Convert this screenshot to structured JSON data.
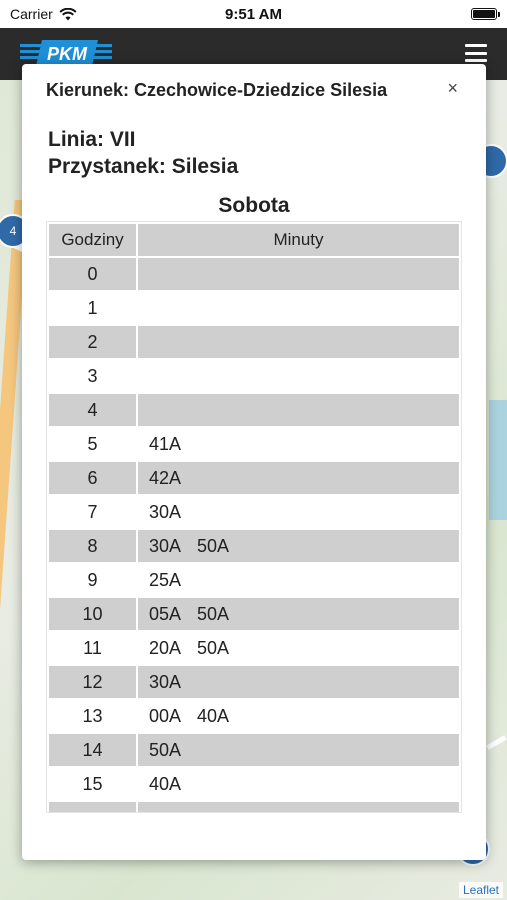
{
  "status": {
    "carrier": "Carrier",
    "time": "9:51 AM"
  },
  "app": {
    "logo_text": "PKM"
  },
  "map": {
    "marker_label": "4",
    "attribution": "Leaflet"
  },
  "modal": {
    "title": "Kierunek: Czechowice-Dziedzice Silesia",
    "close": "×",
    "line": "Linia: VII",
    "stop": "Przystanek: Silesia",
    "day": "Sobota"
  },
  "table": {
    "headers": {
      "hours": "Godziny",
      "minutes": "Minuty"
    },
    "rows": [
      {
        "hour": "0",
        "minutes": ""
      },
      {
        "hour": "1",
        "minutes": ""
      },
      {
        "hour": "2",
        "minutes": ""
      },
      {
        "hour": "3",
        "minutes": ""
      },
      {
        "hour": "4",
        "minutes": ""
      },
      {
        "hour": "5",
        "minutes": "41A"
      },
      {
        "hour": "6",
        "minutes": "42A"
      },
      {
        "hour": "7",
        "minutes": "30A"
      },
      {
        "hour": "8",
        "minutes": "30A 50A"
      },
      {
        "hour": "9",
        "minutes": "25A"
      },
      {
        "hour": "10",
        "minutes": "05A 50A"
      },
      {
        "hour": "11",
        "minutes": "20A 50A"
      },
      {
        "hour": "12",
        "minutes": "30A"
      },
      {
        "hour": "13",
        "minutes": "00A 40A"
      },
      {
        "hour": "14",
        "minutes": "50A"
      },
      {
        "hour": "15",
        "minutes": "40A"
      },
      {
        "hour": "",
        "minutes": ""
      }
    ]
  },
  "colors": {
    "header_bg": "#2b2b2b",
    "logo_blue": "#1f8fd6",
    "row_shade": "#cfcfcf"
  }
}
